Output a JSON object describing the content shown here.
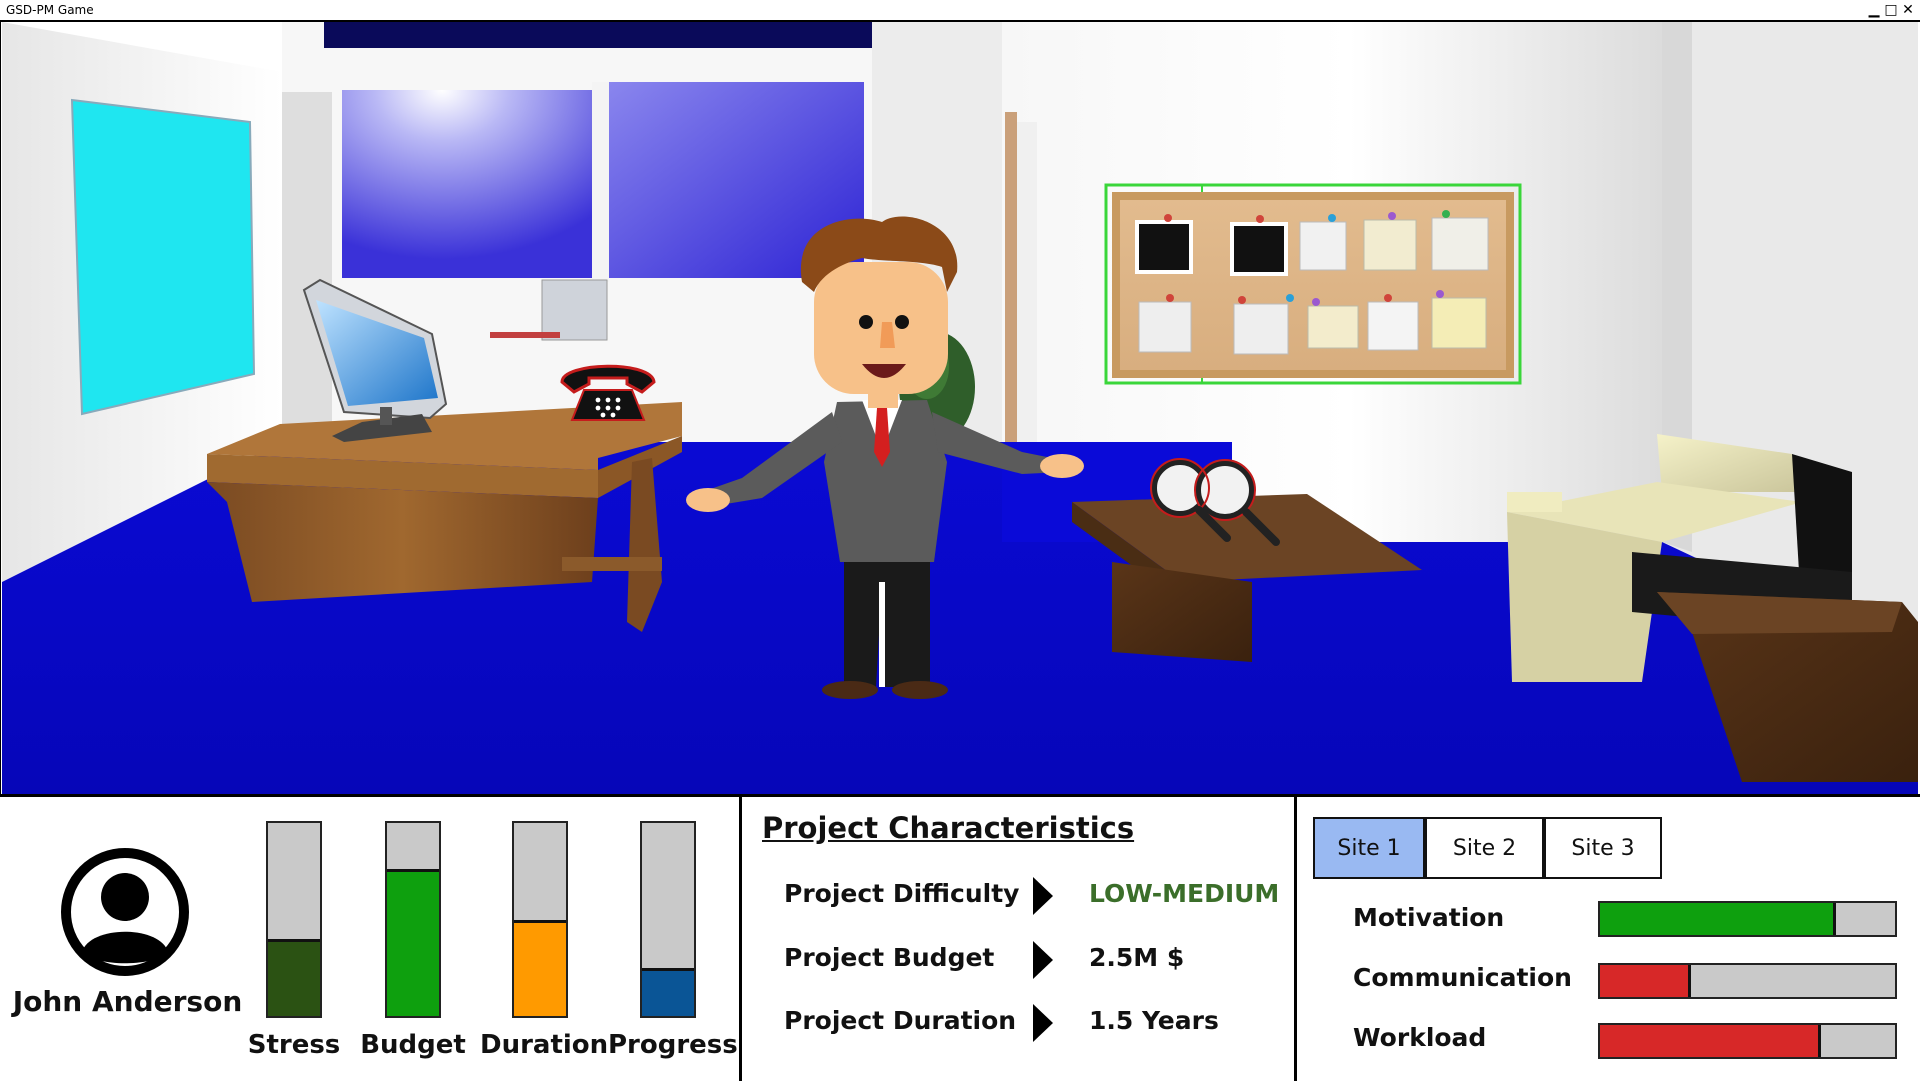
{
  "window": {
    "title": "GSD-PM Game",
    "controls": {
      "minimize": "▁",
      "maximize": "□",
      "close": "✕"
    }
  },
  "scene": {
    "interactive_objects": [
      "computer-icon",
      "telephone-icon",
      "magnifier-icon",
      "notice-board"
    ]
  },
  "player": {
    "name": "John Anderson",
    "icon": "user-avatar-icon"
  },
  "stats": [
    {
      "label": "Stress",
      "level": 0.4,
      "color": "#2b5213"
    },
    {
      "label": "Budget",
      "level": 0.76,
      "color": "#0ea00e"
    },
    {
      "label": "Duration",
      "level": 0.5,
      "color": "#ff9a00"
    },
    {
      "label": "Progress",
      "level": 0.25,
      "color": "#0a5596"
    }
  ],
  "project": {
    "title": "Project Characteristics",
    "rows": [
      {
        "label": "Project Difficulty",
        "value": "LOW-MEDIUM",
        "color": "#3b6e2a"
      },
      {
        "label": "Project Budget",
        "value": "2.5M $",
        "color": "#111111"
      },
      {
        "label": "Project Duration",
        "value": "1.5 Years",
        "color": "#111111"
      }
    ]
  },
  "sites": {
    "tabs": [
      "Site 1",
      "Site 2",
      "Site 3"
    ],
    "active_tab": 0,
    "metrics": [
      {
        "label": "Motivation",
        "level": 0.8,
        "color": "#0ea00e"
      },
      {
        "label": "Communication",
        "level": 0.31,
        "color": "#d72828"
      },
      {
        "label": "Workload",
        "level": 0.75,
        "color": "#d72828"
      }
    ]
  }
}
